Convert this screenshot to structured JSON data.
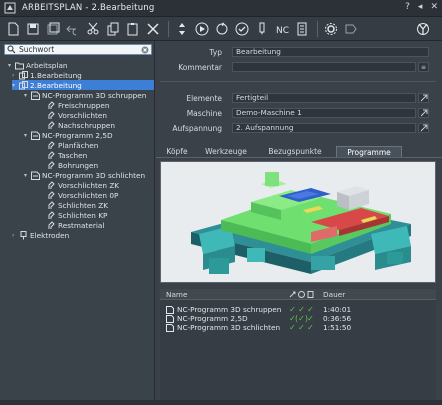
{
  "window": {
    "title": "ARBEITSPLAN - 2.Bearbeitung",
    "help_label": "?",
    "close_label": "✕",
    "pin_label": "◂"
  },
  "search": {
    "placeholder": "Suchwort",
    "value": "Suchwort"
  },
  "tree": [
    {
      "label": "Arbeitsplan",
      "level": 0,
      "arrow": "▾",
      "icon": "folder-icon"
    },
    {
      "label": "1.Bearbeitung",
      "level": 1,
      "arrow": "›",
      "icon": "machining-icon"
    },
    {
      "label": "2.Bearbeitung",
      "level": 1,
      "arrow": "▾",
      "icon": "machining-icon",
      "selected": true
    },
    {
      "label": "NC-Programm 3D schruppen",
      "level": 2,
      "arrow": "▾",
      "icon": "nc-program-icon"
    },
    {
      "label": "Freischruppen",
      "level": 3,
      "arrow": "",
      "icon": "operation-icon"
    },
    {
      "label": "Vorschlichten",
      "level": 3,
      "arrow": "",
      "icon": "operation-icon"
    },
    {
      "label": "Nachschruppen",
      "level": 3,
      "arrow": "",
      "icon": "operation-icon"
    },
    {
      "label": "NC-Programm 2,5D",
      "level": 2,
      "arrow": "▾",
      "icon": "nc-program-icon"
    },
    {
      "label": "Planfächen",
      "level": 3,
      "arrow": "",
      "icon": "operation-icon"
    },
    {
      "label": "Taschen",
      "level": 3,
      "arrow": "",
      "icon": "operation-icon"
    },
    {
      "label": "Bohrungen",
      "level": 3,
      "arrow": "",
      "icon": "operation-icon"
    },
    {
      "label": "NC-Programm 3D schlichten",
      "level": 2,
      "arrow": "▾",
      "icon": "nc-program-icon"
    },
    {
      "label": "Vorschlichten ZK",
      "level": 3,
      "arrow": "",
      "icon": "operation-icon"
    },
    {
      "label": "Vorschlichten 0P",
      "level": 3,
      "arrow": "",
      "icon": "operation-icon"
    },
    {
      "label": "Schlichten ZK",
      "level": 3,
      "arrow": "",
      "icon": "operation-icon"
    },
    {
      "label": "Schlichten KP",
      "level": 3,
      "arrow": "",
      "icon": "operation-icon"
    },
    {
      "label": "Restmaterial",
      "level": 3,
      "arrow": "",
      "icon": "operation-icon"
    },
    {
      "label": "Elektroden",
      "level": 1,
      "arrow": "›",
      "icon": "electrode-icon"
    }
  ],
  "form": {
    "typ_label": "Typ",
    "typ_value": "Bearbeitung",
    "kommentar_label": "Kommentar",
    "kommentar_value": "",
    "elemente_label": "Elemente",
    "elemente_value": "Fertigteil",
    "maschine_label": "Maschine",
    "maschine_value": "Demo-Maschine 1",
    "aufspannung_label": "Aufspannung",
    "aufspannung_value": "2. Aufspannung"
  },
  "tabs": [
    {
      "label": "Köpfe",
      "active": false
    },
    {
      "label": "Werkzeuge",
      "active": false
    },
    {
      "label": "Bezugspunkte",
      "active": false
    },
    {
      "label": "Programme",
      "active": true
    }
  ],
  "programs": {
    "headers": {
      "name": "Name",
      "c1": "",
      "c2": "",
      "c3": "",
      "time": "Dauer"
    },
    "rows": [
      {
        "name": "NC-Programm 3D schruppen",
        "c1": "✓",
        "c2": "✓",
        "c3": "✓",
        "time": "1:40:01"
      },
      {
        "name": "NC-Programm 2,5D",
        "c1": "✓",
        "c2": "(✓)",
        "c3": "✓",
        "time": "0:36:56"
      },
      {
        "name": "NC-Programm 3D schlichten",
        "c1": "✓",
        "c2": "✓",
        "c3": "✓",
        "time": "1:51:50"
      }
    ]
  },
  "colors": {
    "accent": "#3d7fd6",
    "background": "#3a4148",
    "check": "#5cc94a",
    "model_green": "#6fe070",
    "model_red": "#d94848",
    "model_teal": "#3fb8b8"
  }
}
